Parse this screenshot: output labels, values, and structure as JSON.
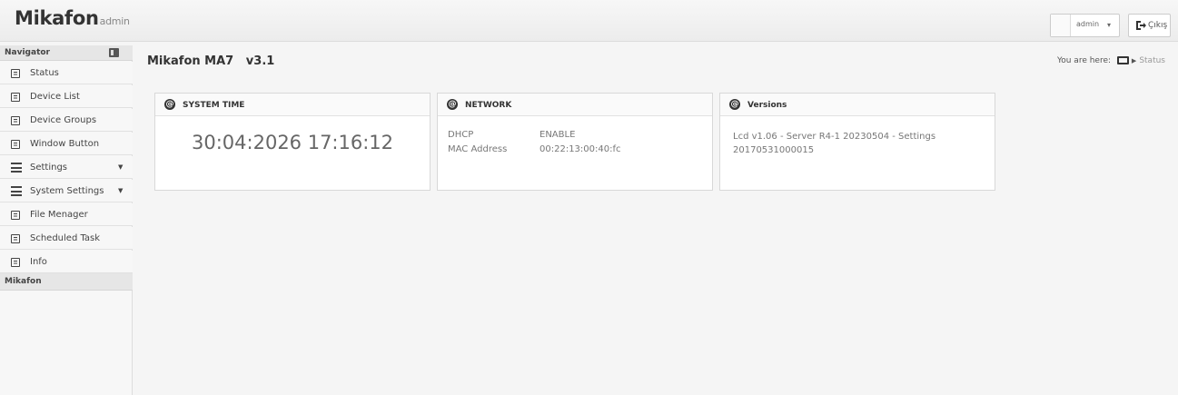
{
  "header": {
    "brand": "Mikafon",
    "brand_sub": "admin",
    "user_name": "admin",
    "logout_label": "Çıkış"
  },
  "sidebar": {
    "title": "Navigator",
    "items": [
      {
        "label": "Status",
        "icon": "document-icon"
      },
      {
        "label": "Device List",
        "icon": "document-icon"
      },
      {
        "label": "Device Groups",
        "icon": "document-icon"
      },
      {
        "label": "Window Button",
        "icon": "document-icon"
      },
      {
        "label": "Settings",
        "icon": "list-icon",
        "expandable": true
      },
      {
        "label": "System Settings",
        "icon": "list-icon",
        "expandable": true
      },
      {
        "label": "File Menager",
        "icon": "document-icon"
      },
      {
        "label": "Scheduled Task",
        "icon": "document-icon"
      },
      {
        "label": "Info",
        "icon": "document-icon"
      }
    ],
    "section2_title": "Mikafon"
  },
  "main": {
    "title": "Mikafon MA7   v3.1",
    "breadcrumb_prefix": "You are here:",
    "breadcrumb_current": "Status",
    "cards": {
      "system_time": {
        "title": "SYSTEM TIME",
        "value": "30:04:2026 17:16:12"
      },
      "network": {
        "title": "NETWORK",
        "rows": [
          {
            "key": "DHCP",
            "value": "ENABLE"
          },
          {
            "key": "MAC Address",
            "value": "00:22:13:00:40:fc"
          }
        ]
      },
      "versions": {
        "title": "Versions",
        "text": "Lcd v1.06 - Server R4-1 20230504 - Settings 20170531000015"
      }
    }
  }
}
